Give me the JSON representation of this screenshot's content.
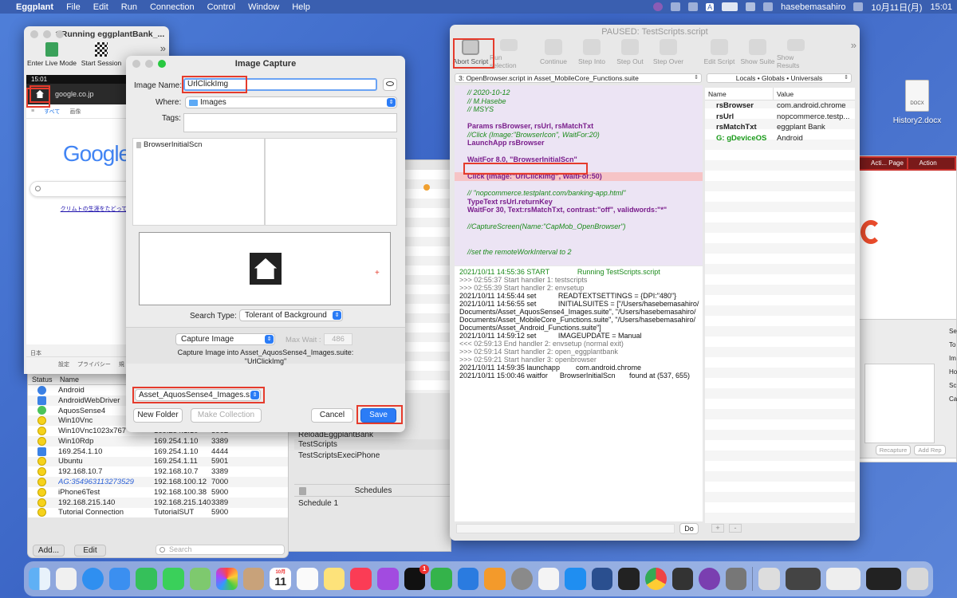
{
  "menubar": {
    "apple": "",
    "app_name": "Eggplant",
    "menus": [
      "File",
      "Edit",
      "Run",
      "Connection",
      "Control",
      "Window",
      "Help"
    ],
    "user": "hasebemasahiro",
    "date": "10月11日(月)",
    "time": "15:01"
  },
  "desktop": {
    "file_name": "History2.docx"
  },
  "running_window": {
    "title": "* Running eggplantBank_...",
    "toolbar": [
      "Enter Live Mode",
      "Start Session"
    ],
    "phone_time": "15:01",
    "url": "google.co.jp",
    "tabs": [
      "すべて",
      "画像"
    ],
    "google": "Google",
    "hint": "クリムトの生涯をたどってみ",
    "footer_country": "日本",
    "footer_links": [
      "設定",
      "プライバシー",
      "規"
    ]
  },
  "connection_list": {
    "headers": [
      "Status",
      "Name"
    ],
    "rows": [
      {
        "status": "blue",
        "name": "Android",
        "host": "",
        "port": ""
      },
      {
        "status": "blue-square",
        "name": "AndroidWebDriver",
        "host": "",
        "port": ""
      },
      {
        "status": "green-check",
        "name": "AquosSense4",
        "host": "",
        "port": ""
      },
      {
        "status": "yellow",
        "name": "Win10Vnc",
        "host": "",
        "port": ""
      },
      {
        "status": "yellow",
        "name": "Win10Vnc1023x767",
        "host": "169.254.1.10",
        "port": "5902"
      },
      {
        "status": "yellow",
        "name": "Win10Rdp",
        "host": "169.254.1.10",
        "port": "3389"
      },
      {
        "status": "blue-square",
        "name": "169.254.1.10",
        "host": "169.254.1.10",
        "port": "4444"
      },
      {
        "status": "yellow",
        "name": "Ubuntu",
        "host": "169.254.1.11",
        "port": "5901"
      },
      {
        "status": "yellow",
        "name": "192.168.10.7",
        "host": "192.168.10.7",
        "port": "3389"
      },
      {
        "status": "yellow",
        "name": "AG:354963113273529",
        "host": "192.168.100.12",
        "port": "7000"
      },
      {
        "status": "yellow",
        "name": "iPhone6Test",
        "host": "192.168.100.38",
        "port": "5900"
      },
      {
        "status": "yellow",
        "name": "192.168.215.140",
        "host": "192.168.215.140",
        "port": "3389"
      },
      {
        "status": "yellow",
        "name": "Tutorial Connection",
        "host": "TutorialSUT",
        "port": "5900"
      }
    ],
    "add_label": "Add...",
    "edit_label": "Edit",
    "search_placeholder": "Search"
  },
  "suite_panel": {
    "items": [
      "ReloadEggplantBank",
      "TestScripts",
      "TestScriptsExeciPhone"
    ],
    "schedules_header": "Schedules",
    "schedule_item": "Schedule 1"
  },
  "image_capture": {
    "title": "Image Capture",
    "image_name_label": "Image Name:",
    "image_name_value": "UrlClickImg",
    "where_label": "Where:",
    "where_value": "Images",
    "tags_label": "Tags:",
    "browser_item": "BrowserInitialScn",
    "search_type_label": "Search Type:",
    "search_type_value": "Tolerant of Background",
    "capture_mode": "Capture Image",
    "max_wait_label": "Max Wait :",
    "max_wait_value": "486",
    "capture_desc": "Capture Image into Asset_AquosSense4_Images.suite:",
    "capture_desc2": "\"UrlClickImg\"",
    "suite_select": "Asset_AquosSense4_Images.s...",
    "new_folder": "New Folder",
    "make_collection": "Make Collection",
    "cancel": "Cancel",
    "save": "Save"
  },
  "script_window": {
    "title": "PAUSED: TestScripts.script",
    "toolbar": [
      "Abort Script",
      "Run selection",
      "Continue",
      "Step Into",
      "Step Out",
      "Step Over",
      "Edit Script",
      "Show Suite",
      "Show Results"
    ],
    "handler_select": "3: OpenBrowser.script in Asset_MobileCore_Functions.suite",
    "vars_select": "Locals • Globals • Universals",
    "code_lines": [
      {
        "t": "cm",
        "v": "// 2020-10-12"
      },
      {
        "t": "cm",
        "v": "// M.Hasebe"
      },
      {
        "t": "cm",
        "v": "// MSYS"
      },
      {
        "t": "blank",
        "v": ""
      },
      {
        "t": "kw",
        "v": "Params rsBrowser, rsUrl, rsMatchTxt"
      },
      {
        "t": "cm",
        "v": "//Click (Image:\"BrowserIcon\", WaitFor:20)"
      },
      {
        "t": "kw",
        "v": "LaunchApp rsBrowser"
      },
      {
        "t": "blank",
        "v": ""
      },
      {
        "t": "kw",
        "v": "WaitFor 8.0, \"BrowserInitialScn\""
      },
      {
        "t": "blank",
        "v": ""
      },
      {
        "t": "hl",
        "v": "Click (Image:\"UrlClickImg\", WaitFor:50)"
      },
      {
        "t": "blank",
        "v": ""
      },
      {
        "t": "cm",
        "v": "// \"nopcommerce.testplant.com/banking-app.html\""
      },
      {
        "t": "kw",
        "v": "TypeText rsUrl.returnKey"
      },
      {
        "t": "kw",
        "v": "WaitFor 30, Text:rsMatchTxt, contrast:\"off\", validwords:\"*\""
      },
      {
        "t": "blank",
        "v": ""
      },
      {
        "t": "cm",
        "v": "//CaptureScreen(Name:\"CapMob_OpenBrowser\")"
      },
      {
        "t": "blank",
        "v": ""
      },
      {
        "t": "blank",
        "v": ""
      },
      {
        "t": "cm",
        "v": "//set the remoteWorkInterval to 2"
      }
    ],
    "log_lines": [
      {
        "g": false,
        "v": "2021/10/11 14:55:36 START              Running TestScripts.script",
        "start": true
      },
      {
        "g": true,
        "v": ">>> 02:55:37 Start handler 1: testscripts"
      },
      {
        "g": true,
        "v": ">>> 02:55:39 Start handler 2: envsetup"
      },
      {
        "g": false,
        "v": "2021/10/11 14:55:44 set           READTEXTSETTINGS = {DPI:\"480\"}"
      },
      {
        "g": false,
        "v": "2021/10/11 14:56:55 set           INITIALSUITES = [\"/Users/hasebemasahiro/"
      },
      {
        "g": false,
        "v": "Documents/Asset_AquosSense4_Images.suite\", \"/Users/hasebemasahiro/"
      },
      {
        "g": false,
        "v": "Documents/Asset_MobileCore_Functions.suite\", \"/Users/hasebemasahiro/"
      },
      {
        "g": false,
        "v": "Documents/Asset_Android_Functions.suite\"]"
      },
      {
        "g": false,
        "v": "2021/10/11 14:59:12 set           IMAGEUPDATE = Manual"
      },
      {
        "g": true,
        "v": "<<< 02:59:13 End handler 2: envsetup (normal exit)"
      },
      {
        "g": true,
        "v": ">>> 02:59:14 Start handler 2: open_eggplantbank"
      },
      {
        "g": true,
        "v": ">>> 02:59:21 Start handler 3: openbrowser"
      },
      {
        "g": false,
        "v": "2021/10/11 14:59:35 launchapp        com.android.chrome"
      },
      {
        "g": false,
        "v": "2021/10/11 15:00:46 waitfor      BrowserInitialScn       found at (537, 655)"
      }
    ],
    "vars_headers": [
      "Name",
      "Value"
    ],
    "vars": [
      {
        "name": "rsBrowser",
        "value": "com.android.chrome",
        "green": false
      },
      {
        "name": "rsUrl",
        "value": "nopcommerce.testp...",
        "green": false
      },
      {
        "name": "rsMatchTxt",
        "value": "eggplant Bank",
        "green": false
      },
      {
        "name": "G: gDeviceOS",
        "value": "Android",
        "green": true
      }
    ],
    "do_label": "Do"
  },
  "right_panel": {
    "tab1": "Acti... Page",
    "tab2": "Action",
    "labels": [
      "Se",
      "To",
      "Im",
      "Ho",
      "Sc",
      "Ca"
    ],
    "recapture": "Recapture",
    "add_rep": "Add Rep"
  },
  "dock": {
    "calendar_month": "10月",
    "calendar_day": "11",
    "badge": "1"
  }
}
